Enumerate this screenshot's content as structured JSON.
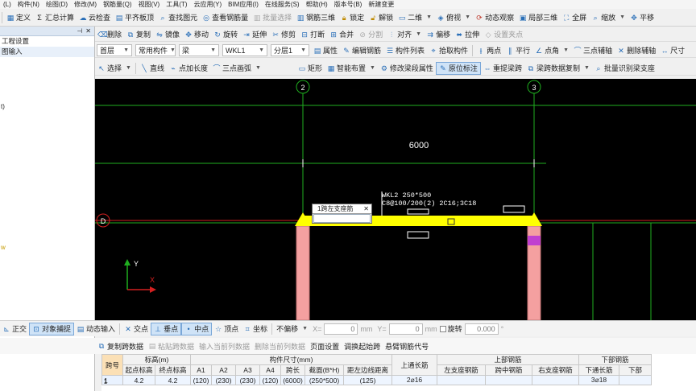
{
  "menubar": [
    "(L)",
    "构件(N)",
    "绘图(D)",
    "修改(M)",
    "钢筋量(Q)",
    "视图(V)",
    "工具(T)",
    "云应用(Y)",
    "BIM应用(I)",
    "在线服务(S)",
    "帮助(H)",
    "版本号(B)",
    "新建变更"
  ],
  "toolbar1": [
    "定义",
    "汇总计算",
    "云检查",
    "平齐板顶",
    "查找图元",
    "查看钢筋量",
    "批量选择",
    "钢筋三维",
    "锁定",
    "解锁",
    "二维",
    "俯视",
    "动态观察",
    "局部三维",
    "全屏",
    "缩放",
    "平移"
  ],
  "toolbar2": [
    "删除",
    "复制",
    "镜像",
    "移动",
    "旋转",
    "延伸",
    "修剪",
    "打断",
    "合并",
    "分割",
    "对齐",
    "偏移",
    "拉伸",
    "设置夹点"
  ],
  "toolbar3": {
    "floor": "首层",
    "category": "常用构件",
    "type": "梁",
    "name": "WKL1",
    "layer": "分层1",
    "buttons": [
      "属性",
      "编辑钢筋",
      "构件列表",
      "拾取构件",
      "两点",
      "平行",
      "点角",
      "三点辅轴",
      "删除辅轴",
      "尺寸"
    ]
  },
  "toolbar4": [
    "选择",
    "直线",
    "点加长度",
    "三点画弧",
    "矩形",
    "智能布置",
    "修改梁段属性",
    "原位标注",
    "重提梁跨",
    "梁跨数据复制",
    "批量识别梁支座"
  ],
  "leftpanel": {
    "header_icons": [
      "pin-icon",
      "close-icon"
    ],
    "items": [
      "工程设置",
      "图输入"
    ],
    "fragments": [
      "t)",
      "w"
    ]
  },
  "canvas": {
    "axes": [
      "2",
      "3",
      "D"
    ],
    "dimension": "6000",
    "beam_label_line1": "WKL2 250*500",
    "beam_label_line2": "C8@100/200(2) 2C16;3C18",
    "popup_title": "1跨左支座筋",
    "ucs_x": "X",
    "ucs_y": "Y"
  },
  "statusbar": {
    "buttons": [
      "正交",
      "对象捕捉",
      "动态输入",
      "交点",
      "垂点",
      "中点",
      "顶点",
      "坐标"
    ],
    "offset": "不偏移",
    "x_label": "X=",
    "x_value": "0",
    "mm1": "mm",
    "y_label": "Y=",
    "y_value": "0",
    "mm2": "mm",
    "rotate": "旋转",
    "rotate_value": "0.000",
    "degree": "°"
  },
  "bottomtoolbar": [
    "复制跨数据",
    "粘贴跨数据",
    "输入当前列数据",
    "删除当前列数据",
    "页面设置",
    "调换起始跨",
    "悬臂钢筋代号"
  ],
  "table": {
    "group_headers": {
      "elevation": "标高(m)",
      "size": "构件尺寸(mm)",
      "top_rebar": "上部钢筋",
      "bottom_rebar": "下部钢筋"
    },
    "columns": [
      "跨号",
      "起点标高",
      "终点标高",
      "A1",
      "A2",
      "A3",
      "A4",
      "跨长",
      "截面(B*H)",
      "距左边线距离",
      "上通长筋",
      "左支座钢筋",
      "跨中钢筋",
      "右支座钢筋",
      "下通长筋",
      "下部"
    ],
    "row_index": "1",
    "row": [
      "1",
      "4.2",
      "4.2",
      "(120)",
      "(230)",
      "(230)",
      "(120)",
      "(6000)",
      "(250*500)",
      "(125)",
      "2⌀16",
      "",
      "",
      "",
      "3⌀18",
      ""
    ]
  },
  "colors": {
    "canvas": "#000000",
    "grid": "#1fae1f",
    "beam": "#ffff00",
    "column": "#f4a0a0",
    "axis_d": "#d42020"
  }
}
